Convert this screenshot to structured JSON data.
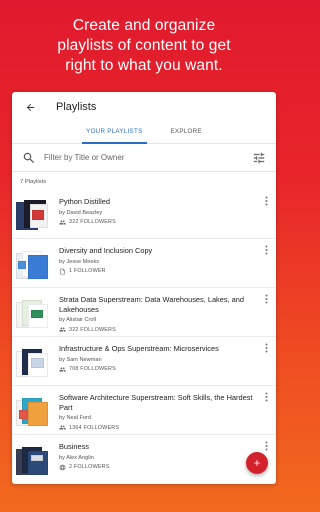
{
  "promo": {
    "line1": "Create and organize",
    "line2": "playlists of content to get",
    "line3": "right to what you want."
  },
  "appbar": {
    "title": "Playlists"
  },
  "tabs": [
    {
      "label": "YOUR PLAYLISTS",
      "active": true
    },
    {
      "label": "EXPLORE",
      "active": false
    }
  ],
  "filter": {
    "placeholder": "Filter by Title or Owner"
  },
  "playlist_count": "7 Playlists",
  "playlists": [
    {
      "title": "Python Distilled",
      "author": "by David Beazley",
      "followers": "322 FOLLOWERS",
      "meta_icon": "people-icon"
    },
    {
      "title": "Diversity and Inclusion Copy",
      "author": "by Jesse Meeks",
      "followers": "1 FOLLOWER",
      "meta_icon": "document-icon"
    },
    {
      "title": "Strata Data Superstream: Data Warehouses, Lakes, and Lakehouses",
      "author": "by Alistair Croll",
      "followers": "322 FOLLOWERS",
      "meta_icon": "people-icon"
    },
    {
      "title": "Infrastructure & Ops Superstream: Microservices",
      "author": "by Sam Newman",
      "followers": "708 FOLLOWERS",
      "meta_icon": "people-icon"
    },
    {
      "title": "Software Architecture Superstream: Soft Skills, the Hardest Part",
      "author": "by Neal Ford",
      "followers": "1364 FOLLOWERS",
      "meta_icon": "people-icon"
    },
    {
      "title": "Business",
      "author": "by Alex Anglin",
      "followers": "2 FOLLOWERS",
      "meta_icon": "globe-icon"
    }
  ],
  "colors": {
    "accent": "#2b6fc4",
    "brand": "#d3222c"
  }
}
